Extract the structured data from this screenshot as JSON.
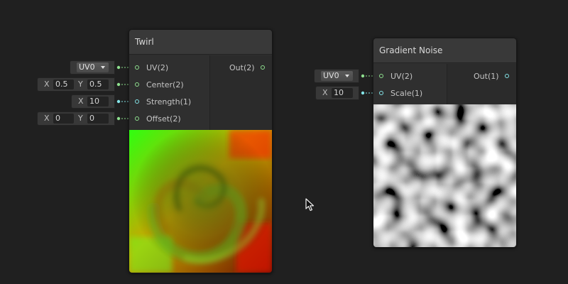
{
  "colors": {
    "canvas": "#202020",
    "vector2_port": "#8ee08e",
    "vector1_port": "#84e4e7"
  },
  "twirl_node": {
    "title": "Twirl",
    "inputs": {
      "uv": "UV(2)",
      "center": "Center(2)",
      "strength": "Strength(1)",
      "offset": "Offset(2)"
    },
    "output": "Out(2)",
    "fields": {
      "uv_dropdown": "UV0",
      "center_x_axis": "X",
      "center_x": "0.5",
      "center_y_axis": "Y",
      "center_y": "0.5",
      "strength_axis": "X",
      "strength": "10",
      "offset_x_axis": "X",
      "offset_x": "0",
      "offset_y_axis": "Y",
      "offset_y": "0"
    }
  },
  "gradient_noise_node": {
    "title": "Gradient Noise",
    "inputs": {
      "uv": "UV(2)",
      "scale": "Scale(1)"
    },
    "output": "Out(1)",
    "fields": {
      "uv_dropdown": "UV0",
      "scale_axis": "X",
      "scale": "10"
    }
  },
  "icons": {
    "dropdown": "chevron-down-icon",
    "cursor": "mouse-pointer-icon"
  }
}
